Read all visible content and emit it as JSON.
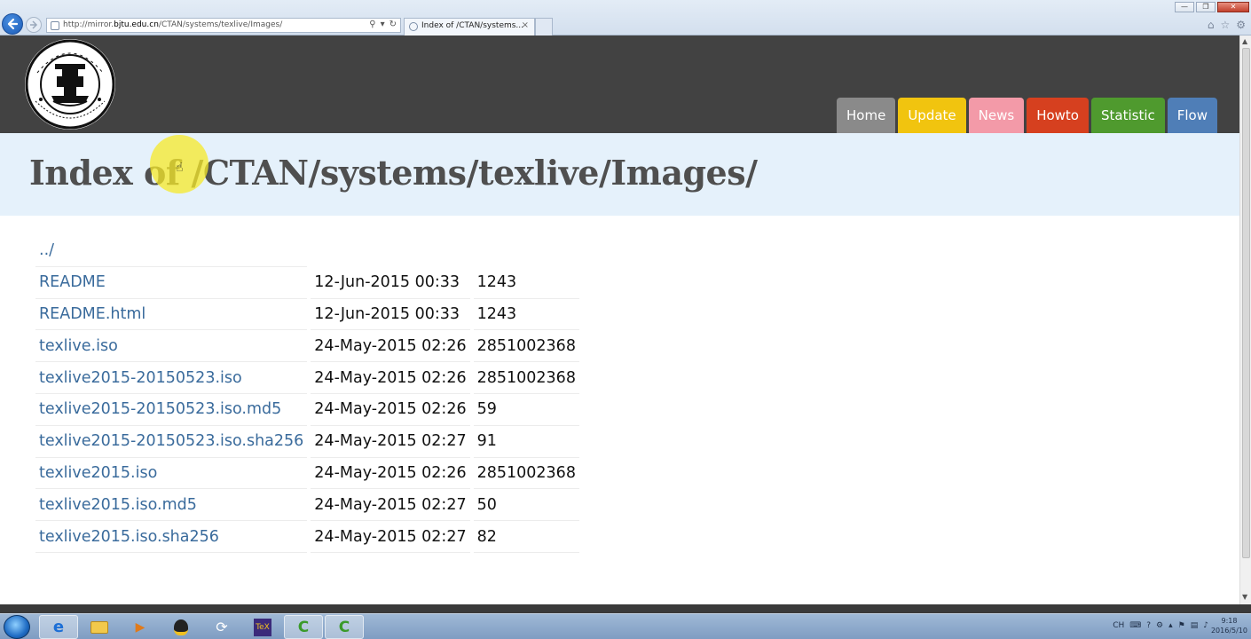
{
  "browser": {
    "url_prefix": "http://mirror.",
    "url_domain": "bjtu.edu.cn",
    "url_path": "/CTAN/systems/texlive/Images/",
    "tab_title": "Index of /CTAN/systems...",
    "tab_close": "×"
  },
  "nav": {
    "items": [
      {
        "label": "Home",
        "color": "#8a8a8a"
      },
      {
        "label": "Update",
        "color": "#f1c40f"
      },
      {
        "label": "News",
        "color": "#f39aa8"
      },
      {
        "label": "Howto",
        "color": "#d6401f"
      },
      {
        "label": "Statistic",
        "color": "#4f9a2e"
      },
      {
        "label": "Flow",
        "color": "#4f7eb7"
      }
    ]
  },
  "page": {
    "title": "Index of /CTAN/systems/texlive/Images/"
  },
  "listing": {
    "parent": "../",
    "rows": [
      {
        "name": "README",
        "date": "12-Jun-2015 00:33",
        "size": "1243"
      },
      {
        "name": "README.html",
        "date": "12-Jun-2015 00:33",
        "size": "1243"
      },
      {
        "name": "texlive.iso",
        "date": "24-May-2015 02:26",
        "size": "2851002368"
      },
      {
        "name": "texlive2015-20150523.iso",
        "date": "24-May-2015 02:26",
        "size": "2851002368"
      },
      {
        "name": "texlive2015-20150523.iso.md5",
        "date": "24-May-2015 02:26",
        "size": "59"
      },
      {
        "name": "texlive2015-20150523.iso.sha256",
        "date": "24-May-2015 02:27",
        "size": "91"
      },
      {
        "name": "texlive2015.iso",
        "date": "24-May-2015 02:26",
        "size": "2851002368"
      },
      {
        "name": "texlive2015.iso.md5",
        "date": "24-May-2015 02:27",
        "size": "50"
      },
      {
        "name": "texlive2015.iso.sha256",
        "date": "24-May-2015 02:27",
        "size": "82"
      }
    ]
  },
  "taskbar": {
    "tray_lang": "CH",
    "clock_time": "9:18",
    "clock_date": "2016/5/10"
  }
}
